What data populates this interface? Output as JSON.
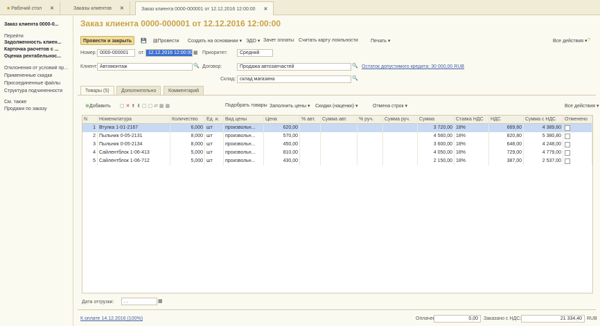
{
  "window_tabs": [
    {
      "label": "Рабочий стол"
    },
    {
      "label": "Заказы клиентов"
    },
    {
      "label": "Заказ клиента 0000-000001 от 12.12.2016 12:00:00"
    }
  ],
  "sidebar": {
    "items": [
      {
        "label": "Заказ клиента 0000-0..."
      },
      {
        "label": "Перейти"
      },
      {
        "label": "Задолженность клиен..."
      },
      {
        "label": "Карточка расчетов с ..."
      },
      {
        "label": "Оценка рентабельнос..."
      },
      {
        "label": "Отклонения от условий пр..."
      },
      {
        "label": "Примененные скидки"
      },
      {
        "label": "Присоединенные файлы"
      },
      {
        "label": "Структура подчиненности"
      },
      {
        "label": "См. также"
      },
      {
        "label": "Продажи по заказу"
      }
    ]
  },
  "title": "Заказ клиента 0000-000001 от 12.12.2016 12:00:00",
  "toolbar": {
    "post_close": "Провести и закрыть",
    "post": "Провести",
    "create_based": "Создать на основании ▾",
    "edo": "ЭДО ▾",
    "payment": "Зачет оплаты",
    "scan": "Считать карту лояльности",
    "print": "Печать ▾",
    "all_actions": "Все действия ▾"
  },
  "form": {
    "number_label": "Номер:",
    "number": "0000-000001",
    "date_label": "от:",
    "date": "12.12.2016 12:00:00",
    "priority_label": "Приоритет:",
    "priority": "Средний",
    "client_label": "Клиент:",
    "client": "Автомонтаж",
    "contract_label": "Договор:",
    "contract": "Продажа автозапчастей",
    "credit_link": "Остаток допустимого кредита: 30 000,00 RUB",
    "warehouse_label": "Склад:",
    "warehouse": "склад магазина"
  },
  "form_tabs": [
    {
      "label": "Товары (5)"
    },
    {
      "label": "Дополнительно"
    },
    {
      "label": "Комментарий"
    }
  ],
  "grid_toolbar": {
    "add": "Добавить",
    "pick": "Подобрать товары",
    "fill_prices": "Заполнить цены ▾",
    "discounts": "Скидки (наценки) ▾",
    "cancel_rows": "Отмена строк ▾",
    "all_actions": "Все действия ▾"
  },
  "columns": [
    "N",
    "Номенклатура",
    "Количество",
    "Ед. и.",
    "Вид цены",
    "Цена",
    "% авт.",
    "Сумма авт.",
    "% руч.",
    "Сумма руч.",
    "Сумма",
    "Ставка НДС",
    "НДС",
    "Сумма с НДС",
    "Отменено"
  ],
  "rows": [
    {
      "n": "1",
      "item": "Втулка 1-01-2167",
      "qty": "6,000",
      "unit": "шт",
      "price_type": "произвольн...",
      "price": "620,00",
      "sum": "3 720,00",
      "vat_rate": "18%",
      "vat": "669,60",
      "total": "4 389,60"
    },
    {
      "n": "2",
      "item": "Пыльник 0-05-2131",
      "qty": "8,000",
      "unit": "шт",
      "price_type": "произвольн...",
      "price": "570,00",
      "sum": "4 560,00",
      "vat_rate": "18%",
      "vat": "820,80",
      "total": "5 380,80"
    },
    {
      "n": "3",
      "item": "Пыльник 0-05-2134",
      "qty": "8,000",
      "unit": "шт",
      "price_type": "произвольн...",
      "price": "450,00",
      "sum": "3 600,00",
      "vat_rate": "18%",
      "vat": "648,00",
      "total": "4 248,00"
    },
    {
      "n": "4",
      "item": "Сайлентблок 1-06-413",
      "qty": "5,000",
      "unit": "шт",
      "price_type": "произвольн...",
      "price": "810,00",
      "sum": "4 050,00",
      "vat_rate": "18%",
      "vat": "729,00",
      "total": "4 779,00"
    },
    {
      "n": "5",
      "item": "Сайлентблок 1-06-712",
      "qty": "5,000",
      "unit": "шт",
      "price_type": "произвольн...",
      "price": "430,00",
      "sum": "2 150,00",
      "vat_rate": "18%",
      "vat": "387,00",
      "total": "2 537,00"
    }
  ],
  "footer": {
    "ship_date_label": "Дата отгрузки:",
    "ship_date": ". .",
    "link": "К оплате 14.12.2016 (100%)",
    "paid_label": "Оплачено:",
    "paid": "0,00",
    "total_label": "Заказано с НДС:",
    "total": "21 334,40",
    "currency": "RUB"
  }
}
